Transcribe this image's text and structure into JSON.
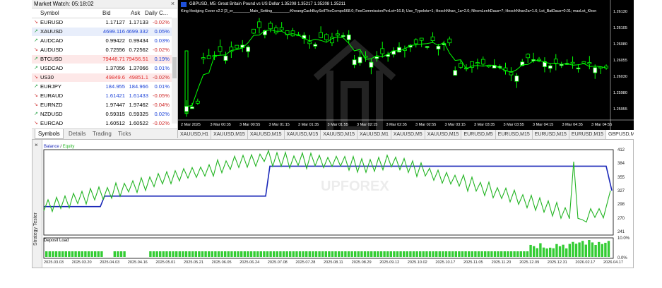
{
  "market_watch": {
    "title": "Market Watch: 05:18:02",
    "columns": [
      "Symbol",
      "Bid",
      "Ask",
      "Daily C..."
    ],
    "rows": [
      {
        "symbol": "EURUSD",
        "bid": "1.17127",
        "ask": "1.17133",
        "change": "-0.02%",
        "dir": "down",
        "red": false
      },
      {
        "symbol": "XAUUSD",
        "bid": "4699.116",
        "ask": "4699.332",
        "change": "0.05%",
        "dir": "up",
        "red": false,
        "blue": true
      },
      {
        "symbol": "AUDCAD",
        "bid": "0.99422",
        "ask": "0.99434",
        "change": "0.03%",
        "dir": "up",
        "red": false
      },
      {
        "symbol": "AUDUSD",
        "bid": "0.72556",
        "ask": "0.72562",
        "change": "-0.02%",
        "dir": "down",
        "red": false
      },
      {
        "symbol": "BTCUSD",
        "bid": "79446.71",
        "ask": "79456.51",
        "change": "0.19%",
        "dir": "up",
        "red": true
      },
      {
        "symbol": "USDCAD",
        "bid": "1.37056",
        "ask": "1.37066",
        "change": "0.01%",
        "dir": "up",
        "red": false
      },
      {
        "symbol": "US30",
        "bid": "49849.6",
        "ask": "49851.1",
        "change": "-0.02%",
        "dir": "down",
        "red": true
      },
      {
        "symbol": "EURJPY",
        "bid": "184.955",
        "ask": "184.966",
        "change": "0.01%",
        "dir": "up",
        "red": false,
        "blue": true
      },
      {
        "symbol": "EURAUD",
        "bid": "1.61421",
        "ask": "1.61433",
        "change": "-0.05%",
        "dir": "down",
        "red": false,
        "blue": true
      },
      {
        "symbol": "EURNZD",
        "bid": "1.97447",
        "ask": "1.97462",
        "change": "-0.04%",
        "dir": "down",
        "red": false
      },
      {
        "symbol": "NZDUSD",
        "bid": "0.59315",
        "ask": "0.59325",
        "change": "0.02%",
        "dir": "up",
        "red": false
      },
      {
        "symbol": "EURCAD",
        "bid": "1.60512",
        "ask": "1.60522",
        "change": "-0.02%",
        "dir": "down",
        "red": false
      }
    ],
    "tabs": [
      "Symbols",
      "Details",
      "Trading",
      "Ticks"
    ],
    "close_glyph": "×"
  },
  "chart": {
    "header": "GBPUSD, M5:  Great Britain Pound vs US Dollar  1.35208 1.35217 1.35208 1.35211",
    "ea_line": "King Hedging Cover v2.2 [3_er________Main_Setting________;KheangCachBuySellThoCompo568.0; FeeCommissionPerLot=16.8; Use_Typelots=1; HeschNhan_1a=2.0; NhomLenhDaus=7; HeschNhan2a=1.6; Lot_BatDaus=0.01; maxLot_Khon",
    "price_labels": [
      "1.26130",
      "1.26105",
      "1.26080",
      "1.26055",
      "1.26030",
      "1.25980",
      "1.25955"
    ],
    "time_labels": [
      "2 Mar 2025",
      "3 Mar 00:35",
      "3 Mar 00:55",
      "3 Mar 01:15",
      "3 Mar 01:35",
      "3 Mar 01:55",
      "3 Mar 02:15",
      "3 Mar 02:35",
      "3 Mar 02:55",
      "3 Mar 03:15",
      "3 Mar 03:35",
      "3 Mar 03:55",
      "3 Mar 04:15",
      "3 Mar 04:35",
      "3 Mar 04:55"
    ],
    "tabs": [
      "XAUUSD,H1",
      "XAUUSD,M15",
      "XAUUSD,M15",
      "XAUUSD,M15",
      "XAUUSD,M15",
      "XAUUSD,M1",
      "XAUUSD,M5",
      "XAUUSD,M15",
      "EURUSD,M5",
      "EURUSD,M15",
      "EURUSD,M15",
      "EURUSD,M15",
      "GBPUSD,M15"
    ],
    "colors": {
      "bg": "#000000",
      "candle_up": "#ffffff",
      "candle_down": "#000000",
      "wick": "#00ff00",
      "ma": "#00ff00"
    }
  },
  "tester": {
    "side_label": "Strategy Tester",
    "close_glyph": "×",
    "legend_balance": "Balance",
    "legend_sep": " / ",
    "legend_equity": "Equity",
    "deposit_load_label": "Deposit Load",
    "y_labels": [
      "412",
      "384",
      "355",
      "327",
      "298",
      "270",
      "241"
    ],
    "dl_labels": [
      "10.0%",
      "0.0%"
    ],
    "x_labels": [
      "2025.03.03",
      "2025.03.20",
      "2025.04.03",
      "2025.04.16",
      "2025.05.01",
      "2025.05.21",
      "2025.06.05",
      "2025.06.24",
      "2025.07.08",
      "2025.07.28",
      "2025.08.11",
      "2025.08.29",
      "2025.09.12",
      "2025.10.02",
      "2025.10.17",
      "2025.11.05",
      "2025.11.20",
      "2025.12.09",
      "2025.12.31",
      "2026.02.17",
      "2026.04.17"
    ],
    "colors": {
      "balance": "#1a28b8",
      "equity": "#22b422",
      "deposit": "#33cc33"
    }
  },
  "watermark_text": "UPFOREX"
}
